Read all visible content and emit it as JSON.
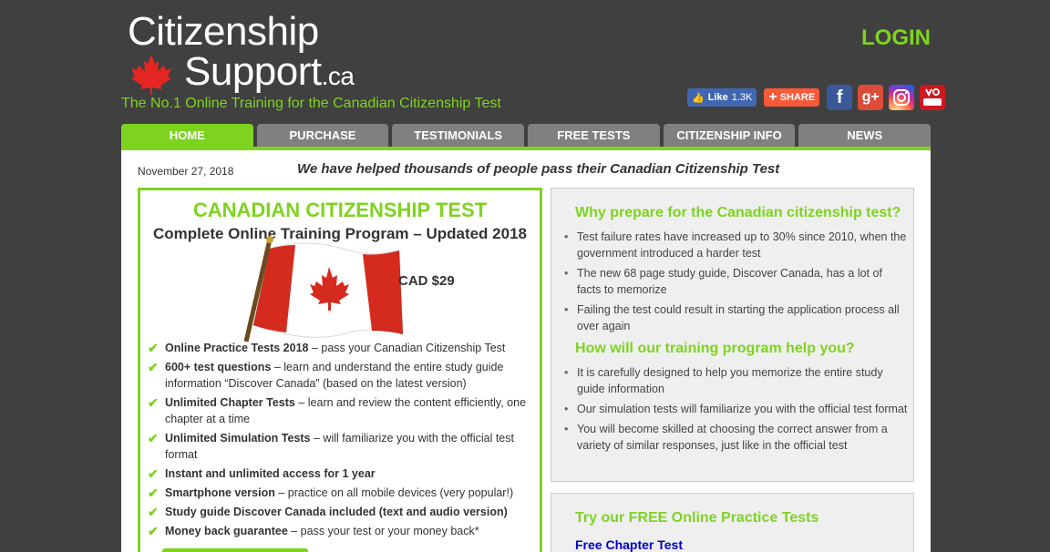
{
  "header": {
    "logo_line1": "Citizenship",
    "logo_line2": "Support",
    "logo_tld": ".ca",
    "tagline": "The No.1 Online Training for the Canadian Citizenship Test",
    "login_label": "LOGIN"
  },
  "social": {
    "like_label": "Like",
    "like_count": "1.3K",
    "share_label": "SHARE",
    "icons": [
      "facebook-icon",
      "google-plus-icon",
      "instagram-icon",
      "youtube-icon"
    ]
  },
  "nav": {
    "tabs": [
      {
        "label": "HOME",
        "active": true
      },
      {
        "label": "PURCHASE",
        "active": false
      },
      {
        "label": "TESTIMONIALS",
        "active": false
      },
      {
        "label": "FREE TESTS",
        "active": false
      },
      {
        "label": "CITIZENSHIP INFO",
        "active": false
      },
      {
        "label": "NEWS",
        "active": false
      }
    ]
  },
  "main": {
    "date": "November 27, 2018",
    "headline": "We have helped thousands of people pass their Canadian Citizenship Test"
  },
  "promo": {
    "title": "CANADIAN CITIZENSHIP TEST",
    "subtitle": "Complete Online Training Program – Updated 2018",
    "price": "CAD $29",
    "features": [
      {
        "bold": "Online Practice Tests 2018",
        "rest": " – pass your Canadian Citizenship Test"
      },
      {
        "bold": "600+ test questions",
        "rest": " – learn and understand the entire study guide information “Discover Canada” (based on the latest version)"
      },
      {
        "bold": "Unlimited Chapter Tests",
        "rest": " – learn and review the content efficiently, one chapter at a time"
      },
      {
        "bold": "Unlimited Simulation Tests",
        "rest": " – will familiarize you with the official test format"
      },
      {
        "bold": "Instant and unlimited access for 1 year",
        "rest": ""
      },
      {
        "bold": "Smartphone version",
        "rest": " – practice on all mobile devices (very popular!)"
      },
      {
        "bold": "Study guide Discover Canada included (text and audio version)",
        "rest": ""
      },
      {
        "bold": "Money back guarantee",
        "rest": " – pass your test or your money back*"
      }
    ]
  },
  "why": {
    "heading1": "Why prepare for the Canadian citizenship test?",
    "list1": [
      "Test failure rates have increased up to 30% since 2010, when the government introduced a harder test",
      "The new 68 page study guide, Discover Canada, has a lot of facts to memorize",
      "Failing the test could result in starting the application process all over again"
    ],
    "heading2": "How will our training program help you?",
    "list2": [
      "It is carefully designed to help you memorize the entire study guide information",
      "Our simulation tests will familiarize you with the official test format",
      "You will become skilled at choosing the correct answer from a variety of similar responses, just like in the official test"
    ]
  },
  "free": {
    "heading": "Try our FREE Online Practice Tests",
    "link": "Free Chapter Test"
  },
  "colors": {
    "accent": "#7ed321",
    "background": "#404040",
    "tab_inactive": "#808080",
    "link": "#0000cc"
  }
}
